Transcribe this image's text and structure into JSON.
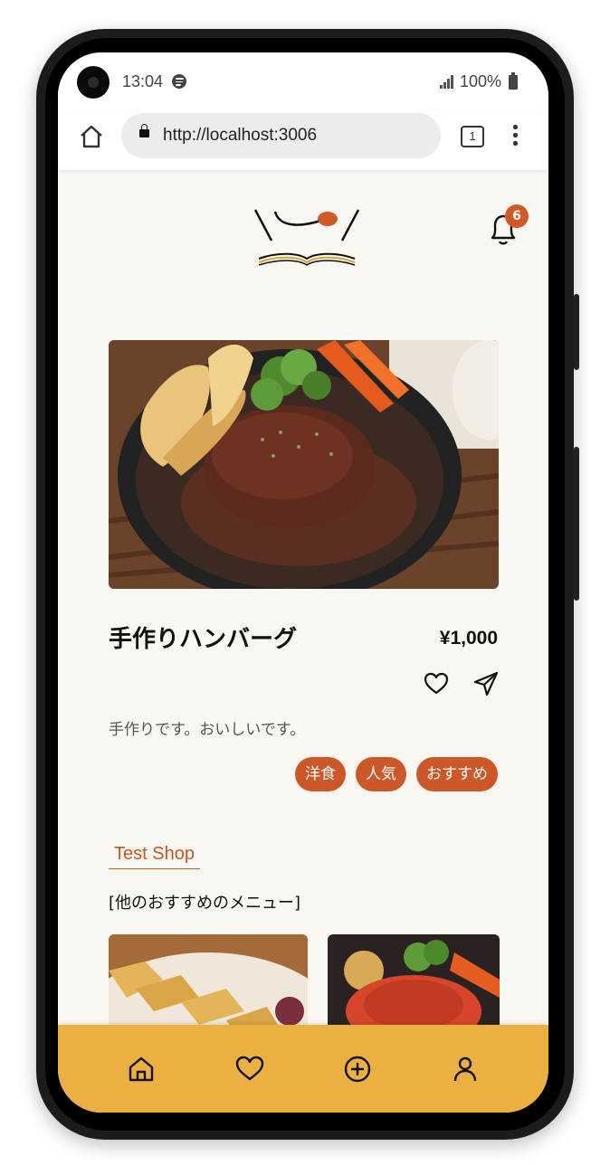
{
  "status_bar": {
    "time": "13:04",
    "battery": "100%"
  },
  "browser": {
    "url": "http://localhost:3006",
    "tab_count": "1"
  },
  "header": {
    "notification_count": "6"
  },
  "product": {
    "title": "手作りハンバーグ",
    "price": "¥1,000",
    "description": "手作りです。おいしいです。",
    "tags": [
      "洋食",
      "人気",
      "おすすめ"
    ]
  },
  "shop": {
    "name": "Test Shop",
    "recommend_label": "[他のおすすめのメニュー]"
  },
  "bottom_nav": {
    "items": [
      "home-icon",
      "heart-icon",
      "plus-circle-icon",
      "user-icon"
    ]
  },
  "colors": {
    "accent": "#cc5829",
    "nav_bg": "#ecb042",
    "page_bg": "#faf6f1"
  }
}
